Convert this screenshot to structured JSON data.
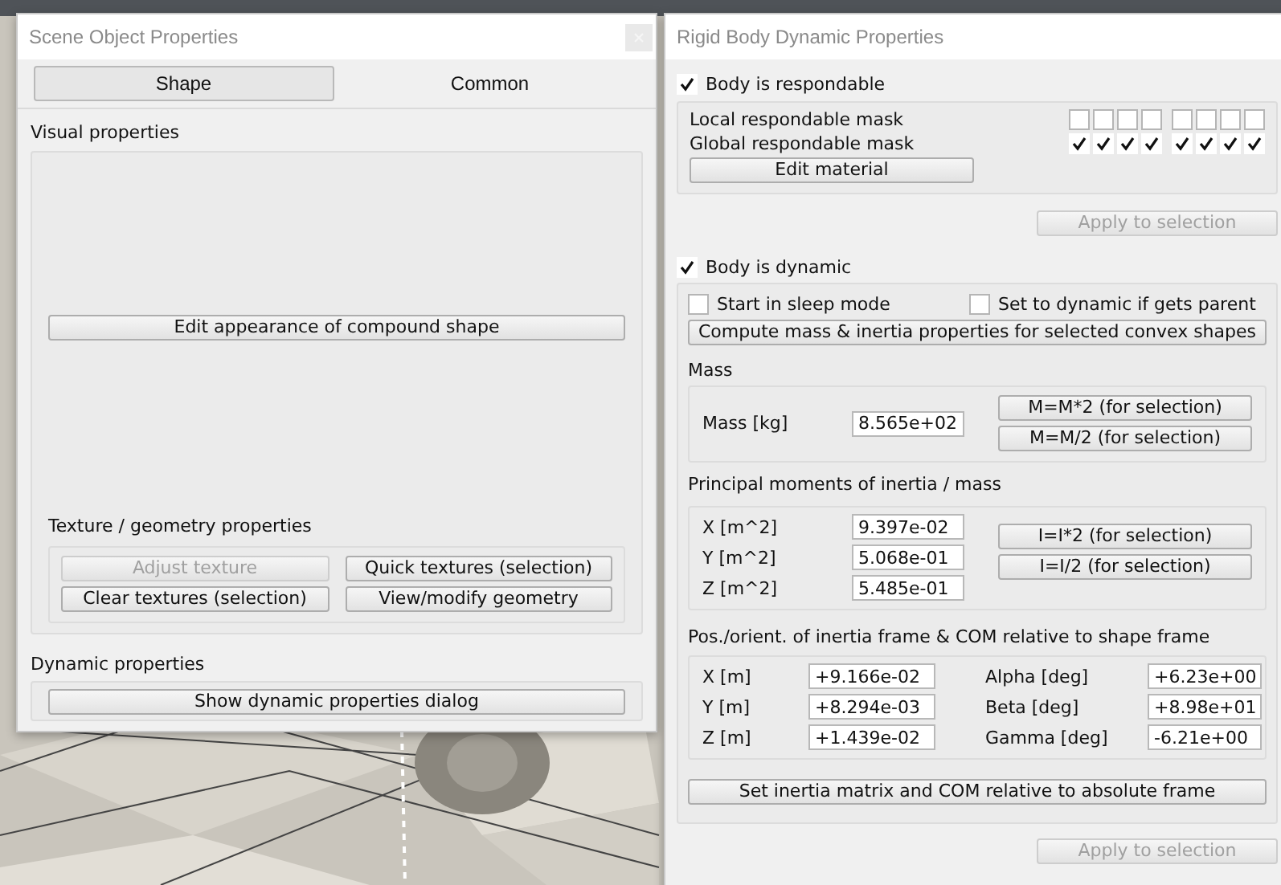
{
  "left_window": {
    "title": "Scene Object Properties",
    "tabs": [
      {
        "label": "Shape",
        "selected": true
      },
      {
        "label": "Common",
        "selected": false
      }
    ],
    "visual_group": {
      "label": "Visual properties",
      "button": "Edit appearance of compound shape"
    },
    "texture_group": {
      "label": "Texture / geometry properties",
      "buttons": [
        {
          "label": "Adjust texture",
          "disabled": true
        },
        {
          "label": "Quick textures (selection)",
          "disabled": false
        },
        {
          "label": "Clear textures (selection)",
          "disabled": false
        },
        {
          "label": "View/modify geometry",
          "disabled": false
        }
      ]
    },
    "dynamic_group": {
      "label": "Dynamic properties",
      "button": "Show dynamic properties dialog"
    }
  },
  "right_window": {
    "title": "Rigid Body Dynamic Properties",
    "respondable": {
      "label": "Body is respondable",
      "checked": true
    },
    "masks": [
      {
        "label": "Local respondable mask",
        "bits": [
          false,
          false,
          false,
          false,
          false,
          false,
          false,
          false
        ]
      },
      {
        "label": "Global respondable mask",
        "bits": [
          true,
          true,
          true,
          true,
          true,
          true,
          true,
          true
        ]
      }
    ],
    "edit_material": "Edit material",
    "apply_top": {
      "label": "Apply to selection",
      "disabled": true
    },
    "dynamic": {
      "label": "Body is dynamic",
      "checked": true
    },
    "options": [
      {
        "label": "Start in sleep mode",
        "checked": false
      },
      {
        "label": "Set to dynamic if gets parent",
        "checked": false
      }
    ],
    "compute_button": "Compute mass & inertia properties for selected convex shapes",
    "mass": {
      "title": "Mass",
      "label": "Mass [kg]",
      "value": "8.565e+02",
      "buttons": [
        "M=M*2  (for selection)",
        "M=M/2  (for selection)"
      ]
    },
    "inertia": {
      "title": "Principal moments of inertia / mass",
      "rows": [
        {
          "label": "X [m^2]",
          "value": "9.397e-02"
        },
        {
          "label": "Y [m^2]",
          "value": "5.068e-01"
        },
        {
          "label": "Z [m^2]",
          "value": "5.485e-01"
        }
      ],
      "buttons": [
        "I=I*2  (for selection)",
        "I=I/2  (for selection)"
      ]
    },
    "frame": {
      "title": "Pos./orient. of inertia frame & COM relative to shape frame",
      "rows": [
        {
          "label": "X [m]",
          "value": "+9.166e-02",
          "angle_label": "Alpha [deg]",
          "angle_value": "+6.23e+00"
        },
        {
          "label": "Y [m]",
          "value": "+8.294e-03",
          "angle_label": "Beta [deg]",
          "angle_value": "+8.98e+01"
        },
        {
          "label": "Z [m]",
          "value": "+1.439e-02",
          "angle_label": "Gamma [deg]",
          "angle_value": "-6.21e+00"
        }
      ]
    },
    "set_button": "Set inertia matrix and COM relative to absolute frame",
    "apply_bottom": {
      "label": "Apply to selection",
      "disabled": true
    }
  }
}
